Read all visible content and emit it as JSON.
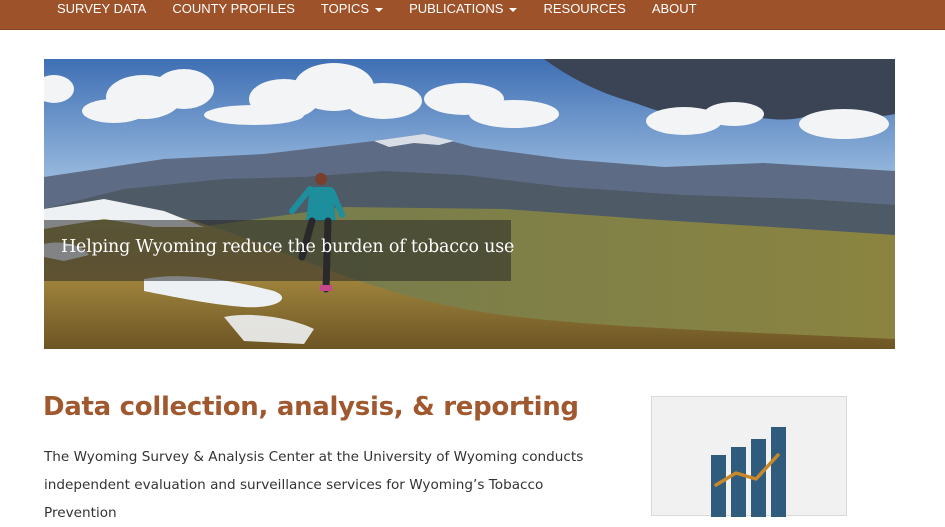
{
  "nav": {
    "items": [
      {
        "label": "SURVEY DATA",
        "dropdown": false
      },
      {
        "label": "COUNTY PROFILES",
        "dropdown": false
      },
      {
        "label": "TOPICS",
        "dropdown": true
      },
      {
        "label": "PUBLICATIONS",
        "dropdown": true
      },
      {
        "label": "RESOURCES",
        "dropdown": false
      },
      {
        "label": "ABOUT",
        "dropdown": false
      }
    ],
    "bg_color": "#9e522a"
  },
  "hero": {
    "caption": "Helping Wyoming reduce the burden of tobacco use"
  },
  "main": {
    "heading": "Data collection, analysis, & reporting",
    "intro": "The Wyoming Survey & Analysis Center at the University of Wyoming conducts independent evaluation and surveillance services for Wyoming’s Tobacco Prevention",
    "heading_color": "#a0582f"
  },
  "card": {
    "icon": "bar-chart-trend-icon",
    "bar_color": "#2f5b7c",
    "line_color": "#c8882a"
  }
}
